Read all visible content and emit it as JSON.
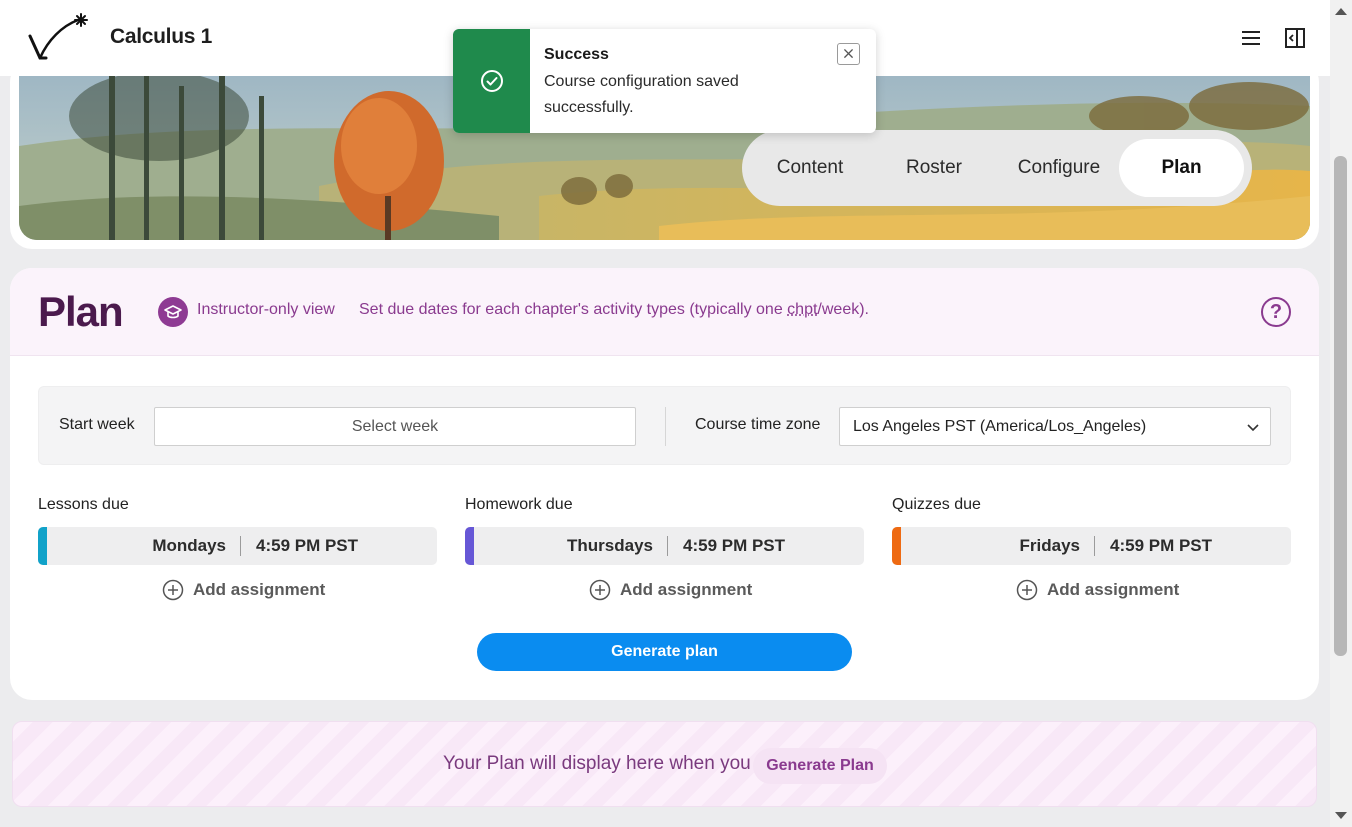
{
  "app": {
    "title": "Calculus 1",
    "logo": "zybooks-style-logo"
  },
  "header": {
    "menu_icon": "hamburger-menu-icon",
    "panel_icon": "side-panel-toggle-icon"
  },
  "toast": {
    "title": "Success",
    "message": "Course configuration saved successfully.",
    "status_color": "#1f8a4c"
  },
  "tabs": [
    {
      "label": "Content",
      "active": false
    },
    {
      "label": "Roster",
      "active": false
    },
    {
      "label": "Configure",
      "active": false
    },
    {
      "label": "Plan",
      "active": true
    }
  ],
  "plan": {
    "title": "Plan",
    "instructor_view": "Instructor-only view",
    "description_prefix": "Set due dates for each chapter's activity types (typically one ",
    "description_abbr": "chpt",
    "description_suffix": "/week).",
    "help": "?"
  },
  "settings": {
    "start_week_label": "Start week",
    "start_week_placeholder": "Select week",
    "timezone_label": "Course time zone",
    "timezone_value": "Los Angeles PST (America/Los_Angeles)"
  },
  "due": [
    {
      "label": "Lessons due",
      "day": "Mondays",
      "time": "4:59 PM PST",
      "color": "#11a2c9",
      "add": "Add assignment"
    },
    {
      "label": "Homework due",
      "day": "Thursdays",
      "time": "4:59 PM PST",
      "color": "#6657d6",
      "add": "Add assignment"
    },
    {
      "label": "Quizzes due",
      "day": "Fridays",
      "time": "4:59 PM PST",
      "color": "#ee6a12",
      "add": "Add assignment"
    }
  ],
  "generate_button": "Generate plan",
  "bottom": {
    "message": "Your Plan will display here when you",
    "button": "Generate Plan"
  },
  "colors": {
    "accent_blue": "#0a8cf0",
    "purple": "#8a3a8f",
    "plan_title": "#4b1a4d"
  }
}
